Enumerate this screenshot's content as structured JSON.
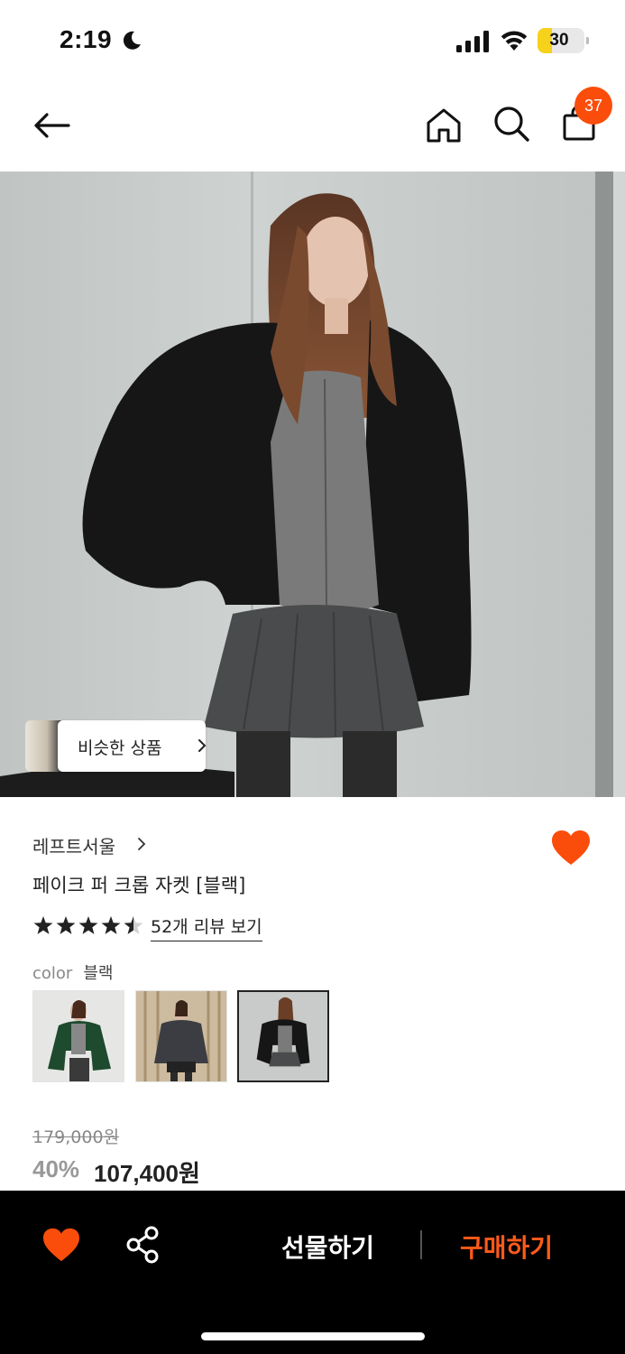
{
  "status_bar": {
    "time": "2:19",
    "battery": "30",
    "battery_level": 0.3
  },
  "nav": {
    "cart_count": "37"
  },
  "hero": {
    "similar_label": "비슷한 상품"
  },
  "product": {
    "brand": "레프트서울",
    "name": "페이크 퍼 크롭 자켓 [블랙]",
    "rating": 4.5,
    "review_link": "52개 리뷰 보기",
    "color_label": "color",
    "color_value": "블랙",
    "original_price": "179,000원",
    "discount": "40%",
    "price": "107,400원"
  },
  "swatches": [
    "green",
    "charcoal",
    "black"
  ],
  "bottom_bar": {
    "gift_label": "선물하기",
    "buy_label": "구매하기"
  },
  "colors": {
    "accent": "#fa4d0b",
    "buy": "#ff5a1a",
    "bar_bg": "#000000"
  }
}
